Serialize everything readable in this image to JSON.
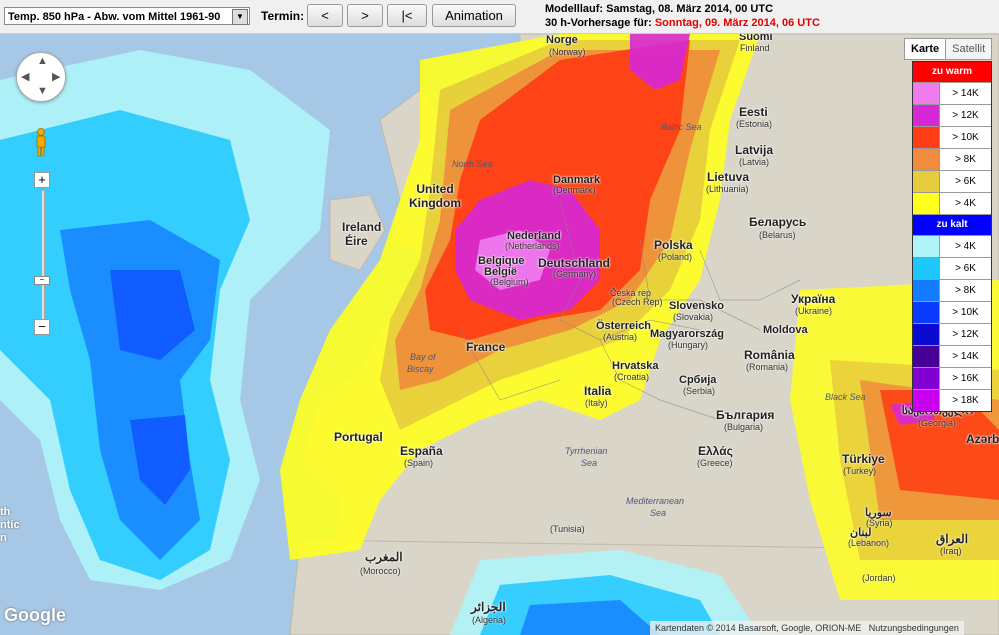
{
  "toolbar": {
    "parameter": "Temp. 850 hPa - Abw. vom Mittel 1961-90",
    "termin_label": "Termin:",
    "buttons": {
      "prev": "<",
      "next": ">",
      "first": "|<",
      "animation": "Animation"
    },
    "modelllauf": "Modelllauf: Samstag, 08. März 2014, 00 UTC",
    "forecast_prefix": "30 h-Vorhersage für:",
    "forecast_date": "Sonntag, 09. März 2014, 06 UTC"
  },
  "map_tabs": {
    "map": "Karte",
    "satellite": "Satellit"
  },
  "legend": {
    "warm_title": "zu warm",
    "warm": [
      {
        "label": "> 14K",
        "color": "#f07cf0"
      },
      {
        "label": "> 12K",
        "color": "#d628d6"
      },
      {
        "label": "> 10K",
        "color": "#ff3c14"
      },
      {
        "label": "> 8K",
        "color": "#f08c3c"
      },
      {
        "label": "> 6K",
        "color": "#e6cc3c"
      },
      {
        "label": "> 4K",
        "color": "#ffff1e"
      }
    ],
    "cold_title": "zu kalt",
    "cold": [
      {
        "label": "> 4K",
        "color": "#aef4f8"
      },
      {
        "label": "> 6K",
        "color": "#1ec8ff"
      },
      {
        "label": "> 8K",
        "color": "#147dff"
      },
      {
        "label": "> 10K",
        "color": "#0a3cff"
      },
      {
        "label": "> 12K",
        "color": "#0a0ad2"
      },
      {
        "label": "> 14K",
        "color": "#460096"
      },
      {
        "label": "> 16K",
        "color": "#8200d2"
      },
      {
        "label": "> 18K",
        "color": "#c800f0"
      }
    ]
  },
  "map_labels": {
    "norge": "Norge",
    "norway": "(Norway)",
    "suomi": "Suomi",
    "finland": "Finland",
    "eesti": "Eesti",
    "estonia": "(Estonia)",
    "latvija": "Latvija",
    "latvia": "(Latvia)",
    "lietuva": "Lietuva",
    "lithuania": "(Lithuania)",
    "united_kingdom": "United Kingdom",
    "ireland": "Ireland",
    "eire": "Éire",
    "danmark": "Danmark",
    "denmark": "(Denmark)",
    "nederland": "Nederland",
    "netherlands": "(Netherlands)",
    "belgique": "Belgique",
    "belgie": "België",
    "belgium": "(Belgium)",
    "deutschland": "Deutschland",
    "germany": "(Germany)",
    "polska": "Polska",
    "poland": "(Poland)",
    "belarus": "Беларусь",
    "belarus_en": "(Belarus)",
    "ukraina": "Україна",
    "ukraine": "(Ukraine)",
    "moldova": "Moldova",
    "ceska": "Česká rep",
    "czech": "(Czech Rep)",
    "slovensko": "Slovensko",
    "slovakia": "(Slovakia)",
    "osterreich": "Österreich",
    "austria": "(Austria)",
    "magyarorszag": "Magyarország",
    "hungary": "(Hungary)",
    "romania": "România",
    "romania_en": "(Romania)",
    "france": "France",
    "hrvatska": "Hrvatska",
    "croatia": "(Croatia)",
    "srbija": "Србија",
    "serbia": "(Serbia)",
    "italia": "Italia",
    "italy": "(Italy)",
    "bulgaria": "България",
    "bulgaria_en": "(Bulgaria)",
    "ellas": "Ελλάς",
    "greece": "(Greece)",
    "portugal": "Portugal",
    "espana": "España",
    "spain": "(Spain)",
    "georgia": "საქართველო",
    "georgia_en": "(Georgia)",
    "azerbaijan": "Azərb",
    "turkiye": "Türkiye",
    "turkey": "(Turkey)",
    "syria": "سوريا",
    "syria_en": "(Syria)",
    "lebanon": "لبنان",
    "lebanon_en": "(Lebanon)",
    "iraq": "العراق",
    "iraq_en": "(Iraq)",
    "jordan_en": "(Jordan)",
    "morocco": "المغرب",
    "morocco_en": "(Morocco)",
    "algeria": "الجزائر",
    "algeria_en": "(Algeria)",
    "tunisia_en": "(Tunisia)",
    "north_sea": "North Sea",
    "baltic_sea": "Baltic Sea",
    "bay_of_biscay_1": "Bay of",
    "bay_of_biscay_2": "Biscay",
    "tyrrhenian_1": "Tyrrhenian",
    "tyrrhenian_2": "Sea",
    "mediterranean_1": "Mediterranean",
    "mediterranean_2": "Sea",
    "black_sea": "Black Sea",
    "atlantic_1": "th",
    "atlantic_2": "ntic",
    "atlantic_3": "n"
  },
  "map_controls": {
    "zoom_in": "+",
    "zoom_out": "−",
    "mid_mark": "−"
  },
  "brand": "Google",
  "footer": {
    "attribution": "Kartendaten © 2014 Basarsoft, Google, ORION-ME",
    "terms": "Nutzungsbedingungen"
  }
}
